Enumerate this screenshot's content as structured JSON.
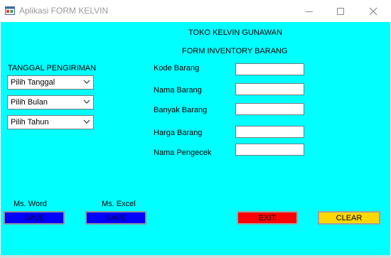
{
  "window": {
    "title": "Aplikasi FORM KELVIN"
  },
  "header": {
    "store_name": "TOKO KELVIN GUNAWAN",
    "form_title": "FORM INVENTORY BARANG"
  },
  "shipping": {
    "label": "TANGGAL PENGIRIMAN",
    "date_select": "Pilih Tanggal",
    "month_select": "Pilih Bulan",
    "year_select": "Pilih Tahun"
  },
  "fields": {
    "kode_barang": {
      "label": "Kode Barang",
      "value": ""
    },
    "nama_barang": {
      "label": "Nama Barang",
      "value": ""
    },
    "banyak_barang": {
      "label": "Banyak Barang",
      "value": ""
    },
    "harga_barang": {
      "label": "Harga Barang",
      "value": ""
    },
    "nama_pengecek": {
      "label": "Nama Pengecek",
      "value": ""
    }
  },
  "export": {
    "word_label": "Ms. Word",
    "excel_label": "Ms. Excel",
    "save_word": "SAVE",
    "save_excel": "SAVE"
  },
  "actions": {
    "exit": "EXIT",
    "clear": "CLEAR"
  },
  "colors": {
    "client_bg": "#00ffff",
    "save_button": "#0000ff",
    "exit_button": "#ff0000",
    "clear_button": "#ffd700"
  }
}
